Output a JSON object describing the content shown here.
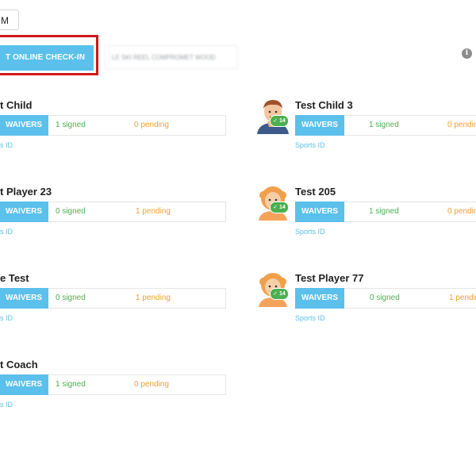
{
  "header": {
    "top_box_text": "M",
    "checkin_button_label": "T ONLINE CHECK-IN WAIVERS",
    "blurred_text": "LE SKI REEL COMPROMET WOOD"
  },
  "left_cards": [
    {
      "name": "t Child",
      "waivers_label": "WAIVERS",
      "signed": "1 signed",
      "pending": "0 pending",
      "sports_id": "s ID"
    },
    {
      "name": "t Player 23",
      "waivers_label": "WAIVERS",
      "signed": "0 signed",
      "pending": "1 pending",
      "sports_id": "s ID"
    },
    {
      "name": "e Test",
      "waivers_label": "WAIVERS",
      "signed": "0 signed",
      "pending": "1 pending",
      "sports_id": "s ID"
    },
    {
      "name": "t Coach",
      "waivers_label": "WAIVERS",
      "signed": "1 signed",
      "pending": "0 pending",
      "sports_id": "s ID"
    }
  ],
  "right_cards": [
    {
      "name": "Test Child 3",
      "waivers_label": "WAIVERS",
      "signed": "1 signed",
      "pending": "0 pendin",
      "sports_id": "Sports ID",
      "avatar": "boy-avatar-icon",
      "badge": "14"
    },
    {
      "name": "Test 205",
      "waivers_label": "WAIVERS",
      "signed": "1 signed",
      "pending": "0 pendin",
      "sports_id": "Sports ID",
      "avatar": "orange-hair-avatar-icon",
      "badge": "14"
    },
    {
      "name": "Test Player 77",
      "waivers_label": "WAIVERS",
      "signed": "0 signed",
      "pending": "1 pendin",
      "sports_id": "Sports ID",
      "avatar": "orange-hair-avatar-icon",
      "badge": "14"
    }
  ],
  "colors": {
    "accent": "#5bc0eb",
    "signed": "#4caf50",
    "pending": "#f0a030",
    "highlight": "#d0161b"
  }
}
